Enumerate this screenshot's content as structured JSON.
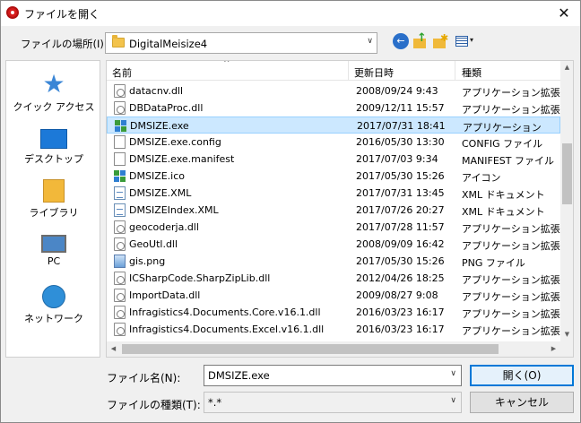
{
  "window": {
    "title": "ファイルを開く",
    "close_glyph": "✕"
  },
  "location": {
    "label": "ファイルの場所(I):",
    "value": "DigitalMeisize4"
  },
  "toolbar": {
    "back_glyph": "←",
    "up_glyph": "↑",
    "new_folder_glyph": "✱",
    "view_glyph": "▾"
  },
  "places": [
    {
      "label": "クイック アクセス",
      "icon": "star-icon"
    },
    {
      "label": "デスクトップ",
      "icon": "desktop-icon"
    },
    {
      "label": "ライブラリ",
      "icon": "library-icon"
    },
    {
      "label": "PC",
      "icon": "pc-icon"
    },
    {
      "label": "ネットワーク",
      "icon": "network-icon"
    }
  ],
  "columns": {
    "name": "名前",
    "date": "更新日時",
    "type": "種類",
    "sort_glyph": "^"
  },
  "files": [
    {
      "name": "datacnv.dll",
      "date": "2008/09/24 9:43",
      "type": "アプリケーション拡張",
      "icon": "dll"
    },
    {
      "name": "DBDataProc.dll",
      "date": "2009/12/11 15:57",
      "type": "アプリケーション拡張",
      "icon": "dll"
    },
    {
      "name": "DMSIZE.exe",
      "date": "2017/07/31 18:41",
      "type": "アプリケーション",
      "icon": "exe"
    },
    {
      "name": "DMSIZE.exe.config",
      "date": "2016/05/30 13:30",
      "type": "CONFIG ファイル",
      "icon": "doc"
    },
    {
      "name": "DMSIZE.exe.manifest",
      "date": "2017/07/03 9:34",
      "type": "MANIFEST ファイル",
      "icon": "doc"
    },
    {
      "name": "DMSIZE.ico",
      "date": "2017/05/30 15:26",
      "type": "アイコン",
      "icon": "ico"
    },
    {
      "name": "DMSIZE.XML",
      "date": "2017/07/31 13:45",
      "type": "XML ドキュメント",
      "icon": "xml"
    },
    {
      "name": "DMSIZEIndex.XML",
      "date": "2017/07/26 20:27",
      "type": "XML ドキュメント",
      "icon": "xml"
    },
    {
      "name": "geocoderja.dll",
      "date": "2017/07/28 11:57",
      "type": "アプリケーション拡張",
      "icon": "dll"
    },
    {
      "name": "GeoUtl.dll",
      "date": "2008/09/09 16:42",
      "type": "アプリケーション拡張",
      "icon": "dll"
    },
    {
      "name": "gis.png",
      "date": "2017/05/30 15:26",
      "type": "PNG ファイル",
      "icon": "png"
    },
    {
      "name": "ICSharpCode.SharpZipLib.dll",
      "date": "2012/04/26 18:25",
      "type": "アプリケーション拡張",
      "icon": "dll"
    },
    {
      "name": "ImportData.dll",
      "date": "2009/08/27 9:08",
      "type": "アプリケーション拡張",
      "icon": "dll"
    },
    {
      "name": "Infragistics4.Documents.Core.v16.1.dll",
      "date": "2016/03/23 16:17",
      "type": "アプリケーション拡張",
      "icon": "dll"
    },
    {
      "name": "Infragistics4.Documents.Excel.v16.1.dll",
      "date": "2016/03/23 16:17",
      "type": "アプリケーション拡張",
      "icon": "dll"
    }
  ],
  "selected_index": 2,
  "filename": {
    "label": "ファイル名(N):",
    "value": "DMSIZE.exe"
  },
  "filetype": {
    "label": "ファイルの種類(T):",
    "value": "*.*"
  },
  "buttons": {
    "open": "開く(O)",
    "cancel": "キャンセル"
  },
  "scroll_glyphs": {
    "up": "▲",
    "down": "▼",
    "left": "◀",
    "right": "▶",
    "combo": "∨"
  }
}
